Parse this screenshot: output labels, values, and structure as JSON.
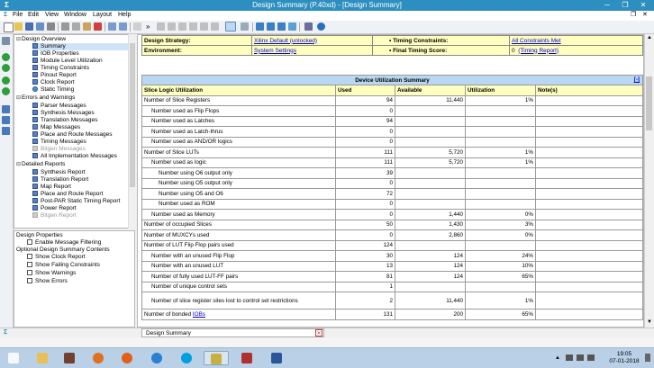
{
  "window": {
    "title": "Design Summary (P.40xd) - [Design Summary]",
    "app_icon": "xilinx-logo-icon"
  },
  "menu": [
    "File",
    "Edit",
    "View",
    "Window",
    "Layout",
    "Help"
  ],
  "tree": {
    "design_overview": "Design Overview",
    "overview_items": [
      "Summary",
      "IOB Properties",
      "Module Level Utilization",
      "Timing Constraints",
      "Pinout Report",
      "Clock Report",
      "Static Timing"
    ],
    "errors_warnings": "Errors and Warnings",
    "ew_items": [
      "Parser Messages",
      "Synthesis Messages",
      "Translation Messages",
      "Map Messages",
      "Place and Route Messages",
      "Timing Messages",
      "Bitgen Messages",
      "All Implementation Messages"
    ],
    "detailed_reports": "Detailed Reports",
    "dr_items": [
      "Synthesis Report",
      "Translation Report",
      "Map Report",
      "Place and Route Report",
      "Post-PAR Static Timing Report",
      "Power Report",
      "Bitgen Report"
    ]
  },
  "properties": {
    "design_properties": "Design Properties",
    "enable_filtering": "Enable Message Filtering",
    "optional_contents": "Optional Design Summary Contents",
    "options": [
      "Show Clock Report",
      "Show Failing Constraints",
      "Show Warnings",
      "Show Errors"
    ]
  },
  "summary": {
    "strategy_label": "Design Strategy:",
    "strategy_value": "Xilinx Default (unlocked)",
    "timing_constraints_label": "• Timing Constraints:",
    "timing_constraints_value": "All Constraints Met",
    "environment_label": "Environment:",
    "environment_value": "System Settings",
    "final_timing_label": "• Final Timing Score:",
    "final_timing_value": "0",
    "timing_report_link": "(Timing Report)"
  },
  "utilization": {
    "caption": "Device Utilization Summary",
    "collapse": "[-]",
    "headers": [
      "Slice Logic Utilization",
      "Used",
      "Available",
      "Utilization",
      "Note(s)"
    ],
    "rows": [
      {
        "label": "Number of Slice Registers",
        "indent": 0,
        "used": "94",
        "avail": "11,440",
        "util": "1%"
      },
      {
        "label": "Number used as Flip Flops",
        "indent": 1,
        "used": "0",
        "avail": "",
        "util": ""
      },
      {
        "label": "Number used as Latches",
        "indent": 1,
        "used": "94",
        "avail": "",
        "util": ""
      },
      {
        "label": "Number used as Latch-thrus",
        "indent": 1,
        "used": "0",
        "avail": "",
        "util": ""
      },
      {
        "label": "Number used as AND/OR logics",
        "indent": 1,
        "used": "0",
        "avail": "",
        "util": ""
      },
      {
        "label": "Number of Slice LUTs",
        "indent": 0,
        "used": "111",
        "avail": "5,720",
        "util": "1%"
      },
      {
        "label": "Number used as logic",
        "indent": 1,
        "used": "111",
        "avail": "5,720",
        "util": "1%"
      },
      {
        "label": "Number using O6 output only",
        "indent": 2,
        "used": "39",
        "avail": "",
        "util": ""
      },
      {
        "label": "Number using O5 output only",
        "indent": 2,
        "used": "0",
        "avail": "",
        "util": ""
      },
      {
        "label": "Number using O5 and O6",
        "indent": 2,
        "used": "72",
        "avail": "",
        "util": ""
      },
      {
        "label": "Number used as ROM",
        "indent": 2,
        "used": "0",
        "avail": "",
        "util": ""
      },
      {
        "label": "Number used as Memory",
        "indent": 1,
        "used": "0",
        "avail": "1,440",
        "util": "0%"
      },
      {
        "label": "Number of occupied Slices",
        "indent": 0,
        "used": "50",
        "avail": "1,430",
        "util": "3%"
      },
      {
        "label": "Number of MUXCYs used",
        "indent": 0,
        "used": "0",
        "avail": "2,860",
        "util": "0%"
      },
      {
        "label": "Number of LUT Flip Flop pairs used",
        "indent": 0,
        "used": "124",
        "avail": "",
        "util": ""
      },
      {
        "label": "Number with an unused Flip Flop",
        "indent": 1,
        "used": "30",
        "avail": "124",
        "util": "24%"
      },
      {
        "label": "Number with an unused LUT",
        "indent": 1,
        "used": "13",
        "avail": "124",
        "util": "10%"
      },
      {
        "label": "Number of fully used LUT-FF pairs",
        "indent": 1,
        "used": "81",
        "avail": "124",
        "util": "65%"
      },
      {
        "label": "Number of unique control sets",
        "indent": 1,
        "used": "1",
        "avail": "",
        "util": ""
      },
      {
        "label": "Number of slice register sites lost to control set restrictions",
        "indent": 1,
        "used": "2",
        "avail": "11,440",
        "util": "1%",
        "tall": true
      },
      {
        "label": "Number of bonded ",
        "link": "IOBs",
        "indent": 0,
        "used": "131",
        "avail": "200",
        "util": "65%"
      }
    ]
  },
  "tab_label": "Design Summary",
  "taskbar": {
    "time": "19:05",
    "date": "07-01-2018"
  }
}
